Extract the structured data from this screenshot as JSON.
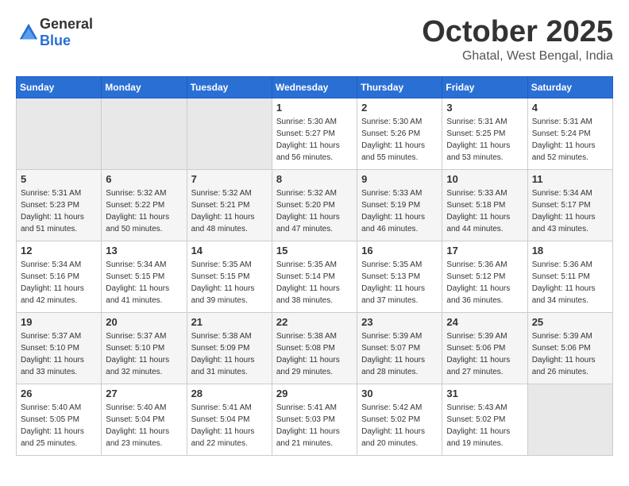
{
  "header": {
    "logo_general": "General",
    "logo_blue": "Blue",
    "month": "October 2025",
    "location": "Ghatal, West Bengal, India"
  },
  "weekdays": [
    "Sunday",
    "Monday",
    "Tuesday",
    "Wednesday",
    "Thursday",
    "Friday",
    "Saturday"
  ],
  "weeks": [
    [
      {
        "day": "",
        "empty": true
      },
      {
        "day": "",
        "empty": true
      },
      {
        "day": "",
        "empty": true
      },
      {
        "day": "1",
        "sunrise": "5:30 AM",
        "sunset": "5:27 PM",
        "daylight": "11 hours and 56 minutes."
      },
      {
        "day": "2",
        "sunrise": "5:30 AM",
        "sunset": "5:26 PM",
        "daylight": "11 hours and 55 minutes."
      },
      {
        "day": "3",
        "sunrise": "5:31 AM",
        "sunset": "5:25 PM",
        "daylight": "11 hours and 53 minutes."
      },
      {
        "day": "4",
        "sunrise": "5:31 AM",
        "sunset": "5:24 PM",
        "daylight": "11 hours and 52 minutes."
      }
    ],
    [
      {
        "day": "5",
        "sunrise": "5:31 AM",
        "sunset": "5:23 PM",
        "daylight": "11 hours and 51 minutes."
      },
      {
        "day": "6",
        "sunrise": "5:32 AM",
        "sunset": "5:22 PM",
        "daylight": "11 hours and 50 minutes."
      },
      {
        "day": "7",
        "sunrise": "5:32 AM",
        "sunset": "5:21 PM",
        "daylight": "11 hours and 48 minutes."
      },
      {
        "day": "8",
        "sunrise": "5:32 AM",
        "sunset": "5:20 PM",
        "daylight": "11 hours and 47 minutes."
      },
      {
        "day": "9",
        "sunrise": "5:33 AM",
        "sunset": "5:19 PM",
        "daylight": "11 hours and 46 minutes."
      },
      {
        "day": "10",
        "sunrise": "5:33 AM",
        "sunset": "5:18 PM",
        "daylight": "11 hours and 44 minutes."
      },
      {
        "day": "11",
        "sunrise": "5:34 AM",
        "sunset": "5:17 PM",
        "daylight": "11 hours and 43 minutes."
      }
    ],
    [
      {
        "day": "12",
        "sunrise": "5:34 AM",
        "sunset": "5:16 PM",
        "daylight": "11 hours and 42 minutes."
      },
      {
        "day": "13",
        "sunrise": "5:34 AM",
        "sunset": "5:15 PM",
        "daylight": "11 hours and 41 minutes."
      },
      {
        "day": "14",
        "sunrise": "5:35 AM",
        "sunset": "5:15 PM",
        "daylight": "11 hours and 39 minutes."
      },
      {
        "day": "15",
        "sunrise": "5:35 AM",
        "sunset": "5:14 PM",
        "daylight": "11 hours and 38 minutes."
      },
      {
        "day": "16",
        "sunrise": "5:35 AM",
        "sunset": "5:13 PM",
        "daylight": "11 hours and 37 minutes."
      },
      {
        "day": "17",
        "sunrise": "5:36 AM",
        "sunset": "5:12 PM",
        "daylight": "11 hours and 36 minutes."
      },
      {
        "day": "18",
        "sunrise": "5:36 AM",
        "sunset": "5:11 PM",
        "daylight": "11 hours and 34 minutes."
      }
    ],
    [
      {
        "day": "19",
        "sunrise": "5:37 AM",
        "sunset": "5:10 PM",
        "daylight": "11 hours and 33 minutes."
      },
      {
        "day": "20",
        "sunrise": "5:37 AM",
        "sunset": "5:10 PM",
        "daylight": "11 hours and 32 minutes."
      },
      {
        "day": "21",
        "sunrise": "5:38 AM",
        "sunset": "5:09 PM",
        "daylight": "11 hours and 31 minutes."
      },
      {
        "day": "22",
        "sunrise": "5:38 AM",
        "sunset": "5:08 PM",
        "daylight": "11 hours and 29 minutes."
      },
      {
        "day": "23",
        "sunrise": "5:39 AM",
        "sunset": "5:07 PM",
        "daylight": "11 hours and 28 minutes."
      },
      {
        "day": "24",
        "sunrise": "5:39 AM",
        "sunset": "5:06 PM",
        "daylight": "11 hours and 27 minutes."
      },
      {
        "day": "25",
        "sunrise": "5:39 AM",
        "sunset": "5:06 PM",
        "daylight": "11 hours and 26 minutes."
      }
    ],
    [
      {
        "day": "26",
        "sunrise": "5:40 AM",
        "sunset": "5:05 PM",
        "daylight": "11 hours and 25 minutes."
      },
      {
        "day": "27",
        "sunrise": "5:40 AM",
        "sunset": "5:04 PM",
        "daylight": "11 hours and 23 minutes."
      },
      {
        "day": "28",
        "sunrise": "5:41 AM",
        "sunset": "5:04 PM",
        "daylight": "11 hours and 22 minutes."
      },
      {
        "day": "29",
        "sunrise": "5:41 AM",
        "sunset": "5:03 PM",
        "daylight": "11 hours and 21 minutes."
      },
      {
        "day": "30",
        "sunrise": "5:42 AM",
        "sunset": "5:02 PM",
        "daylight": "11 hours and 20 minutes."
      },
      {
        "day": "31",
        "sunrise": "5:43 AM",
        "sunset": "5:02 PM",
        "daylight": "11 hours and 19 minutes."
      },
      {
        "day": "",
        "empty": true
      }
    ]
  ],
  "labels": {
    "sunrise_prefix": "Sunrise: ",
    "sunset_prefix": "Sunset: ",
    "daylight_prefix": "Daylight: "
  }
}
